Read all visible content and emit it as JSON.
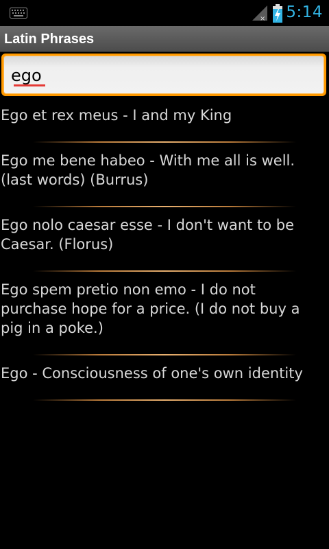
{
  "status_bar": {
    "time": "5:14",
    "icons": [
      "keyboard-icon",
      "signal-icon",
      "battery-charging-icon"
    ],
    "time_color": "#33b5e5"
  },
  "app": {
    "title": "Latin Phrases"
  },
  "search": {
    "value": "ego",
    "accent_color": "#ff9900"
  },
  "results": [
    {
      "text": "Ego et rex meus - I and my King"
    },
    {
      "text": "Ego me bene habeo - With me all is well. (last words) (Burrus)"
    },
    {
      "text": "Ego nolo caesar esse - I don't want to be Caesar. (Florus)"
    },
    {
      "text": "Ego spem pretio non emo - I do not purchase hope for a price. (I do not buy a pig in a poke.)"
    },
    {
      "text": "Ego - Consciousness of one's own identity"
    }
  ]
}
